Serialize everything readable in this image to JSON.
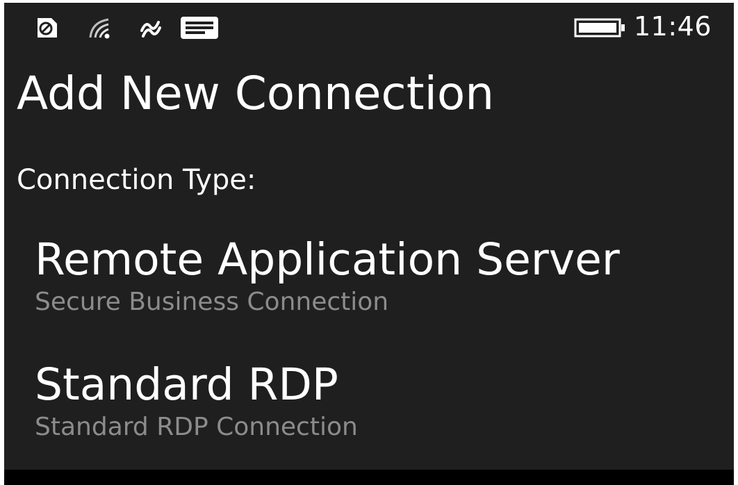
{
  "status_bar": {
    "icons": [
      "sync-icon",
      "wifi-signal-icon",
      "nfc-icon",
      "message-icon",
      "battery-icon"
    ],
    "time": "11:46"
  },
  "page": {
    "title": "Add New Connection",
    "section_label": "Connection Type:"
  },
  "options": [
    {
      "title": "Remote Application Server",
      "subtitle": "Secure Business Connection"
    },
    {
      "title": "Standard RDP",
      "subtitle": "Standard RDP Connection"
    }
  ],
  "colors": {
    "background": "#1f1f1f",
    "text": "#ffffff",
    "subtext": "#8c8c8c"
  }
}
